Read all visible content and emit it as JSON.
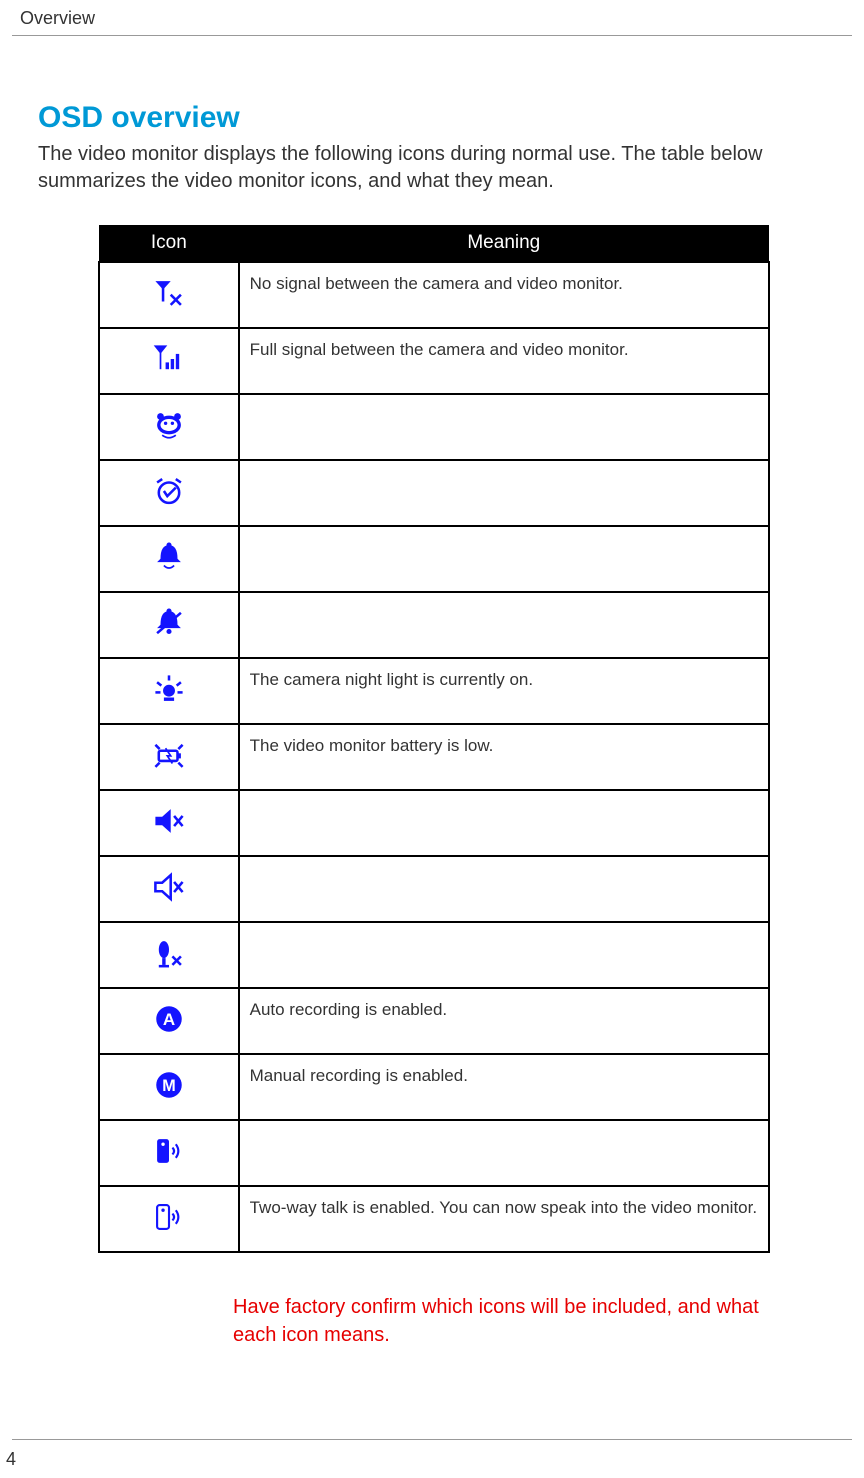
{
  "header": {
    "title": "Overview"
  },
  "section": {
    "title": "OSD overview",
    "intro": "The video monitor displays the following icons during normal use. The table below summarizes the video monitor icons, and what they mean."
  },
  "table": {
    "col_icon": "Icon",
    "col_meaning": "Meaning",
    "rows": [
      {
        "icon": "no-signal-icon",
        "meaning": "No signal between the camera and video monitor."
      },
      {
        "icon": "full-signal-icon",
        "meaning": "Full signal between the camera and video monitor."
      },
      {
        "icon": "alarm-on-icon",
        "meaning": ""
      },
      {
        "icon": "alarm-clock-icon",
        "meaning": ""
      },
      {
        "icon": "bell-icon",
        "meaning": ""
      },
      {
        "icon": "bell-off-icon",
        "meaning": ""
      },
      {
        "icon": "night-light-icon",
        "meaning": "The camera night light is currently on."
      },
      {
        "icon": "battery-low-icon",
        "meaning": "The video monitor battery is low."
      },
      {
        "icon": "speaker-mute-solid-icon",
        "meaning": ""
      },
      {
        "icon": "speaker-mute-outline-icon",
        "meaning": ""
      },
      {
        "icon": "mic-off-icon",
        "meaning": ""
      },
      {
        "icon": "auto-record-icon",
        "meaning": "Auto recording is enabled."
      },
      {
        "icon": "manual-record-icon",
        "meaning": "Manual recording is enabled."
      },
      {
        "icon": "talk-solid-icon",
        "meaning": ""
      },
      {
        "icon": "talk-outline-icon",
        "meaning": "Two-way talk is enabled. You can now speak into the video monitor."
      }
    ]
  },
  "note": "Have factory confirm which icons will be included, and what each icon means.",
  "page_number": "4"
}
